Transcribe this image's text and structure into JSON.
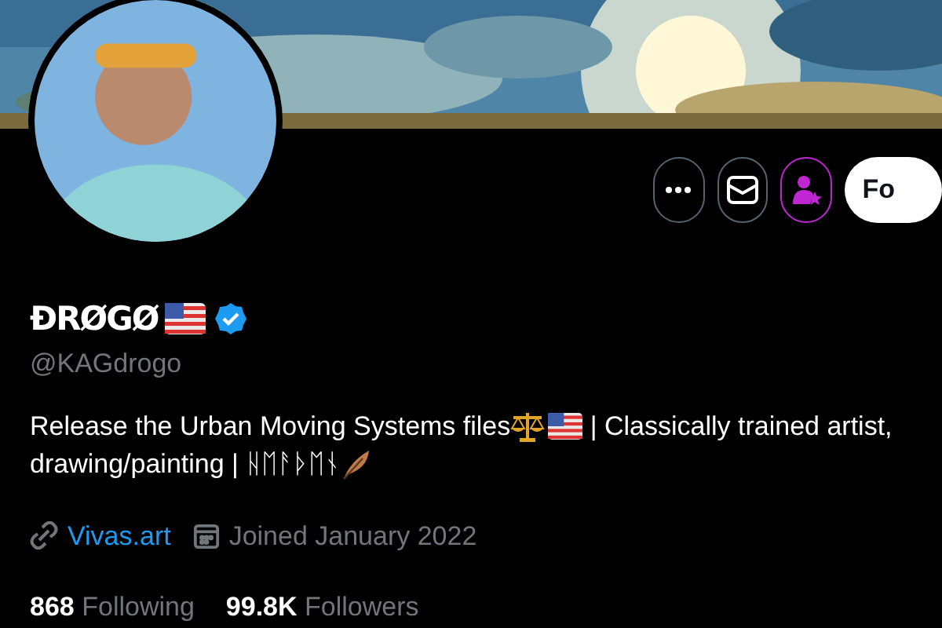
{
  "profile": {
    "name": "ÐRØGØ",
    "verified": true,
    "handle": "@KAGdrogo",
    "bio": [
      {
        "kind": "text",
        "text": "Release the Urban Moving Systems files"
      },
      {
        "kind": "scales"
      },
      {
        "kind": "flag"
      },
      {
        "kind": "text",
        "text": " | Classically trained artist,"
      },
      {
        "kind": "break"
      },
      {
        "kind": "text",
        "text": "drawing/painting | ᚺᛖᚨᚦᛖᚾ"
      },
      {
        "kind": "feather"
      }
    ],
    "website": "Vivas.art",
    "joined": "Joined January 2022",
    "stats": [
      {
        "count": "868",
        "label": "Following"
      },
      {
        "count": "99.8K",
        "label": "Followers"
      }
    ]
  },
  "actions": {
    "subscribed": true,
    "follow_label": "Fo"
  }
}
